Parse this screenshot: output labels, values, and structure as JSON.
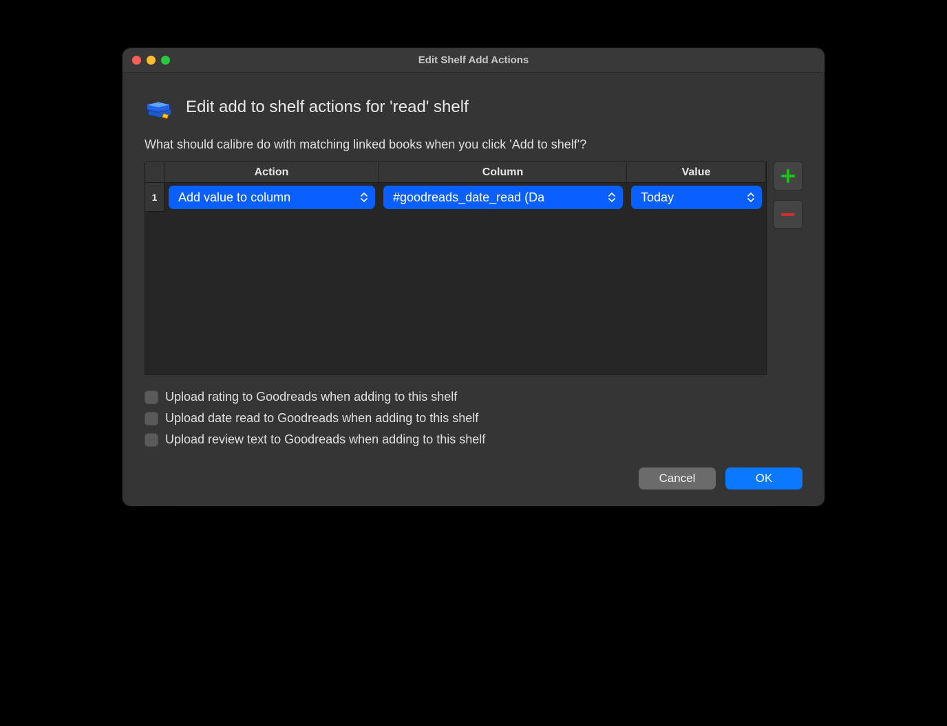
{
  "window": {
    "title": "Edit Shelf Add Actions"
  },
  "header": {
    "title": "Edit add to shelf actions for 'read' shelf"
  },
  "description": "What should calibre do with matching linked books when you click 'Add to shelf'?",
  "table": {
    "headers": {
      "action": "Action",
      "column": "Column",
      "value": "Value"
    },
    "rows": [
      {
        "index": "1",
        "action": "Add value to column",
        "column": "#goodreads_date_read (Da",
        "value": "Today"
      }
    ]
  },
  "checkboxes": {
    "upload_rating": "Upload rating to Goodreads when adding to this shelf",
    "upload_date_read": "Upload date read to Goodreads when adding to this shelf",
    "upload_review": "Upload review text to Goodreads when adding to this shelf"
  },
  "buttons": {
    "cancel": "Cancel",
    "ok": "OK"
  }
}
